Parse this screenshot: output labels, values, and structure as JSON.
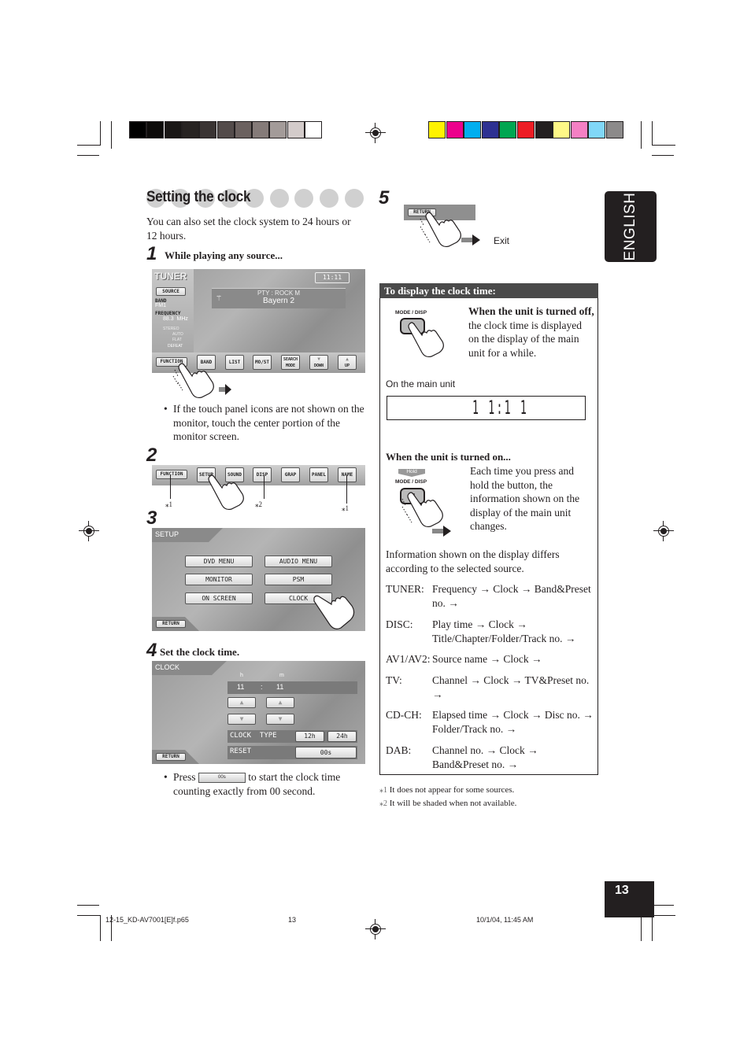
{
  "section": {
    "title": "Setting the clock",
    "intro": "You can also set the clock system to 24 hours or 12 hours."
  },
  "language_tab": "ENGLISH",
  "page_number": "13",
  "steps": {
    "s1": {
      "num": "1",
      "text": "While playing any source...",
      "note": "If the touch panel icons are not shown on the monitor, touch the center portion of the monitor screen."
    },
    "s2": {
      "num": "2"
    },
    "s3": {
      "num": "3"
    },
    "s4": {
      "num": "4",
      "text": "Set the clock time.",
      "note_pre": "Press",
      "note_button": "00s",
      "note_post": "to start the clock time counting exactly from 00 second."
    },
    "s5": {
      "num": "5",
      "exit_label": "Exit"
    }
  },
  "tuner_screen": {
    "title": "TUNER",
    "clock": "11:11",
    "source_btn": "SOURCE",
    "band_label": "BAND",
    "band_value": "FM1",
    "freq_label": "FREQUENCY",
    "freq_value": "88.3  MHz",
    "indicators": [
      "STEREO",
      "AUTO",
      "FLAT",
      "DEFEAT"
    ],
    "pty": "PTY : ROCK M",
    "station": "Bayern 2",
    "buttons": [
      "FUNCTION",
      "BAND",
      "LIST",
      "MO/ST",
      "SEARCH MODE",
      "DOWN",
      "UP"
    ]
  },
  "function_bar": {
    "buttons": [
      "FUNCTION",
      "SETUP",
      "SOUND",
      "DISP",
      "GRAP",
      "PANEL",
      "NAME"
    ],
    "marks": [
      "⁎1",
      "⁎2",
      "⁎1"
    ]
  },
  "setup_screen": {
    "title": "SETUP",
    "buttons": [
      "DVD MENU",
      "AUDIO MENU",
      "MONITOR",
      "PSM",
      "ON SCREEN",
      "CLOCK"
    ],
    "return_btn": "RETURN"
  },
  "clock_screen": {
    "title": "CLOCK",
    "h_label": "h",
    "m_label": "m",
    "hour": "11",
    "sep": ":",
    "minute": "11",
    "clock_type_label": "CLOCK  TYPE",
    "btn_12h": "12h",
    "btn_24h": "24h",
    "reset_label": "RESET",
    "reset_btn": "00s",
    "return_btn": "RETURN"
  },
  "step5_screen": {
    "return_btn": "RETURN"
  },
  "display_box": {
    "header": "To display the clock time:",
    "mode_disp_label": "MODE / DISP",
    "m_button": "M",
    "off_bold": "When the unit is turned off,",
    "off_text": " the clock time is displayed on the display of the main unit for a while.",
    "on_main_unit": "On the main unit",
    "lcd_time": "1 1:1 1",
    "on_heading": "When the unit is turned on...",
    "hold_label": "Hold",
    "on_text": "Each time you press and hold the button, the information shown on the display of the main unit changes.",
    "info_text": "Information shown on the display differs according to the selected source.",
    "sources": [
      {
        "label": "TUNER:",
        "value": "Frequency → Clock → Band&Preset no. →"
      },
      {
        "label": "DISC:",
        "value": "Play time → Clock → Title/Chapter/Folder/Track no. →"
      },
      {
        "label": "AV1/AV2:",
        "value": "Source name → Clock →"
      },
      {
        "label": "TV:",
        "value": "Channel → Clock → TV&Preset no. →"
      },
      {
        "label": "CD-CH:",
        "value": "Elapsed time → Clock → Disc no. → Folder/Track no. →"
      },
      {
        "label": "DAB:",
        "value": "Channel no. → Clock → Band&Preset no. →"
      }
    ]
  },
  "footnotes": [
    {
      "mark": "⁎1",
      "text": "It does not appear for some sources."
    },
    {
      "mark": "⁎2",
      "text": "It will be shaded when not available."
    }
  ],
  "footer": {
    "file": "12-15_KD-AV7001[E]f.p65",
    "page": "13",
    "date": "10/1/04, 11:45 AM"
  },
  "color_bars": {
    "gray": [
      "#000000",
      "#0d0b0a",
      "#1a1716",
      "#272322",
      "#3a3433",
      "#534b4a",
      "#6b615f",
      "#857b79",
      "#a39b99",
      "#d3cbca",
      "#ffffff"
    ],
    "cmyk": [
      "#fff200",
      "#ec008c",
      "#00aeef",
      "#2e3192",
      "#00a651",
      "#ed1c24",
      "#231f20",
      "#fff887",
      "#f580c4",
      "#80d7f7",
      "#8c8a8a"
    ]
  }
}
